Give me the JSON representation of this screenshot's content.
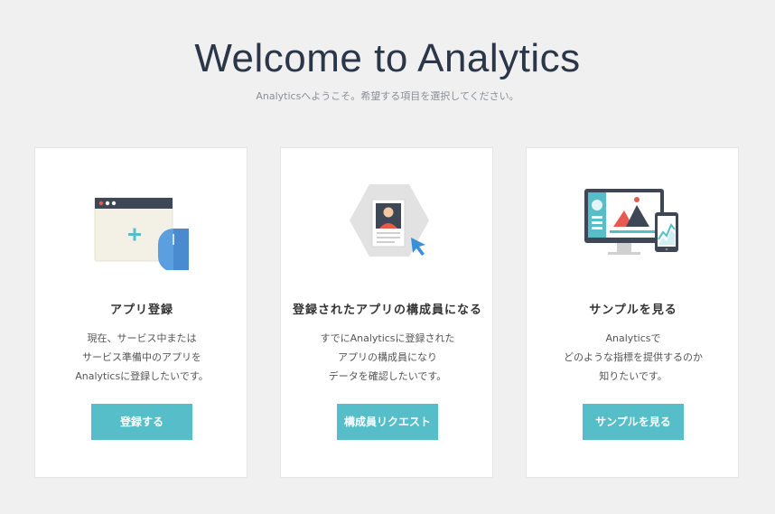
{
  "header": {
    "title": "Welcome to Analytics",
    "subtitle": "Analyticsへようこそ。希望する項目を選択してください。"
  },
  "cards": [
    {
      "title": "アプリ登録",
      "description": [
        "現在、サービス中または",
        "サービス準備中のアプリを",
        "Analyticsに登録したいです。"
      ],
      "button": "登録する",
      "icon": "browser-mouse-icon"
    },
    {
      "title": "登録されたアプリの構成員になる",
      "description": [
        "すでにAnalyticsに登録された",
        "アプリの構成員になり",
        "データを確認したいです。"
      ],
      "button": "構成員リクエスト",
      "icon": "profile-card-icon"
    },
    {
      "title": "サンプルを見る",
      "description": [
        "Analyticsで",
        "どのような指標を提供するのか",
        "知りたいです。"
      ],
      "button": "サンプルを見る",
      "icon": "dashboard-devices-icon"
    }
  ],
  "colors": {
    "accent": "#55bec9",
    "title": "#2b3748",
    "background": "#f0f0f0"
  }
}
